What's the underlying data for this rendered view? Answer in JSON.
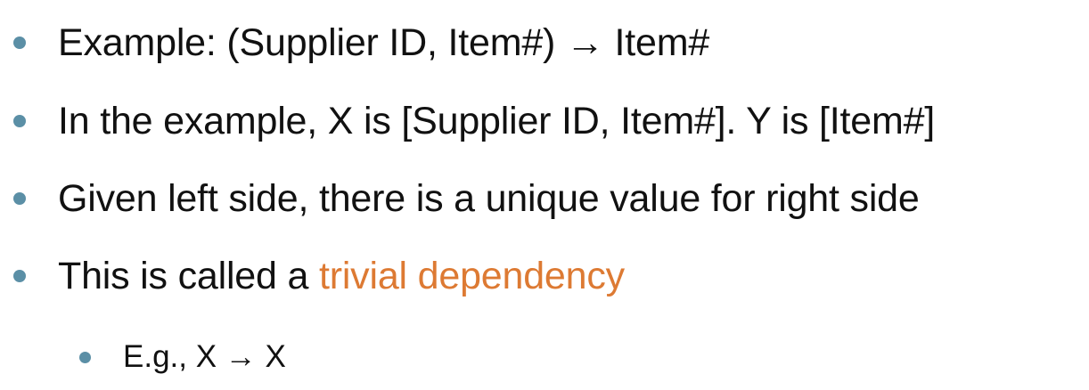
{
  "colors": {
    "bullet": "#5B8FA6",
    "text": "#111111",
    "highlight": "#DD7A33"
  },
  "bullets": [
    {
      "text_before": "Example: (Supplier ID, Item#) ",
      "arrow": "→",
      "text_after": " Item#"
    },
    {
      "text": "In the example, X is [Supplier ID, Item#]. Y is [Item#]"
    },
    {
      "text": "Given left side, there is a unique value for right side"
    },
    {
      "text_before": "This is called a ",
      "highlight": "trivial dependency"
    }
  ],
  "sub_bullet": {
    "text_before": "E.g., X ",
    "arrow": "→",
    "text_after": " X"
  }
}
